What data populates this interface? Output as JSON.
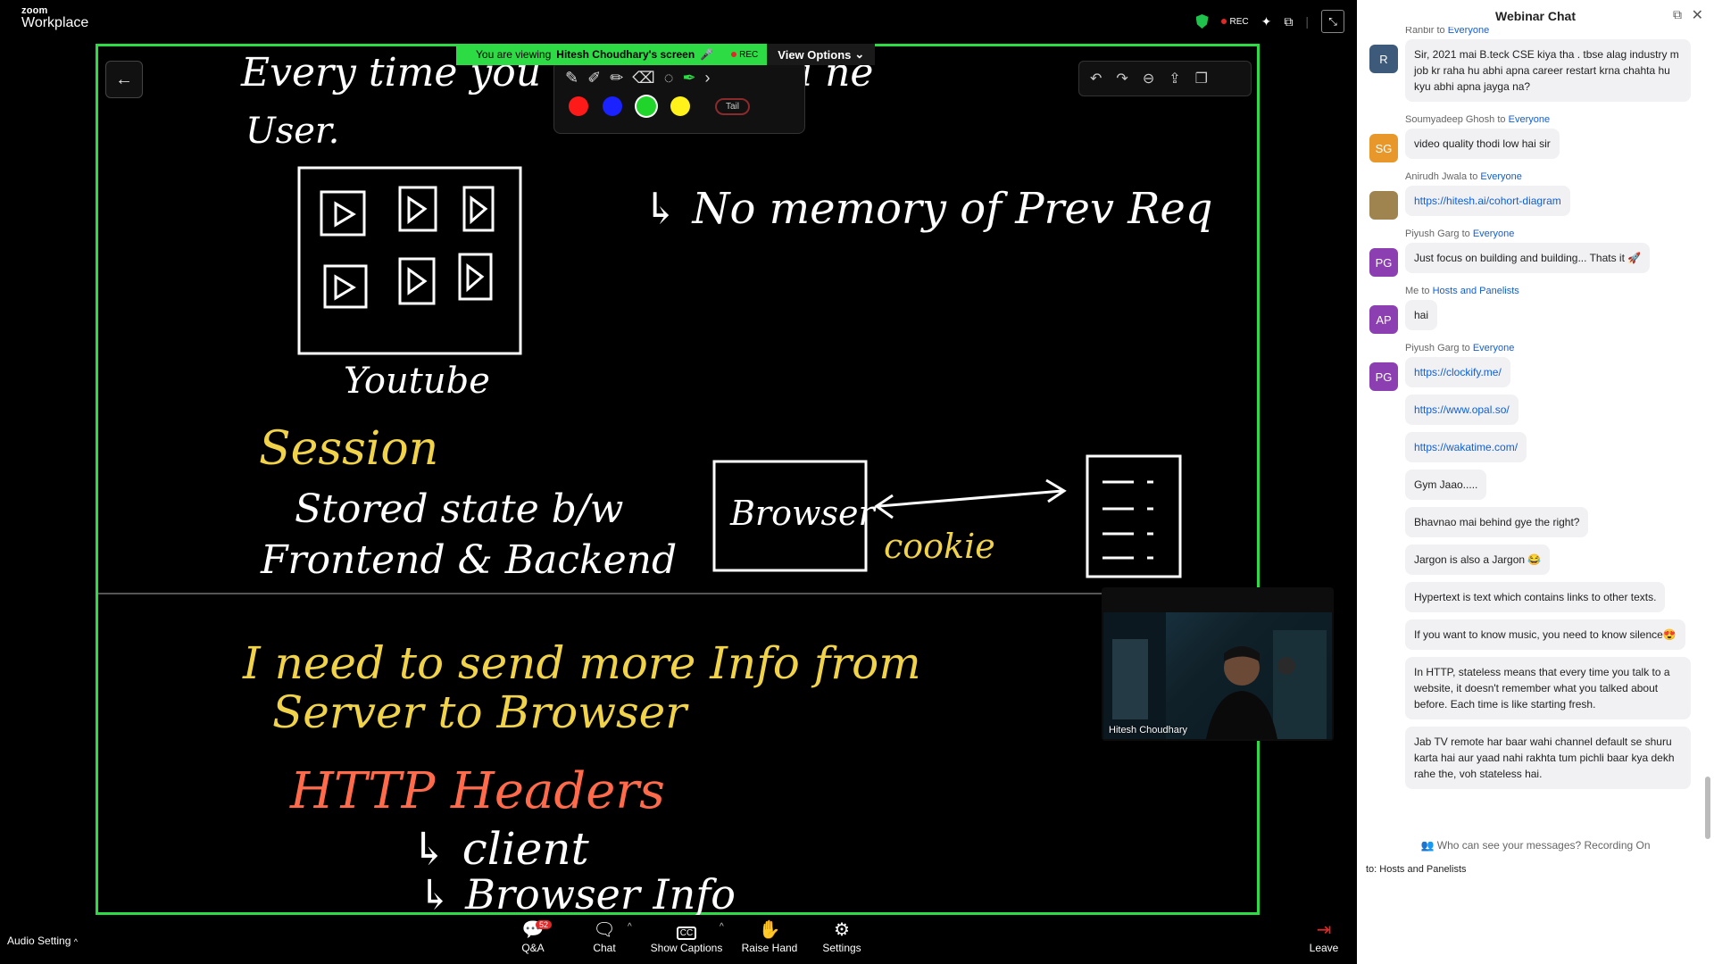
{
  "app": {
    "logo_small": "zoom",
    "logo_big": "Workplace",
    "rec_label": "REC",
    "exit_fullscreen_icon": "minimize-icon"
  },
  "share": {
    "viewing_prefix": "You are viewing",
    "viewing_name": "Hitesh Choudhary's screen",
    "rec_label": "REC",
    "view_options": "View Options",
    "tail_label": "Tail",
    "pen_colors": [
      "#ff1a1a",
      "#1a22ff",
      "#21d42b",
      "#fff21a"
    ]
  },
  "whiteboard": {
    "line1": "Every time you v… you are a ne",
    "line2": "User.",
    "youtube": "Youtube",
    "no_memory": "↳ No memory of Prev Req",
    "session": "Session",
    "stored_state": "Stored state b/w",
    "frontend_backend": "Frontend & Backend",
    "browser": "Browser",
    "cookie": "cookie",
    "need_info_1": "I need to send more Info from",
    "need_info_2": "Server to Browser",
    "http_headers": "HTTP Headers",
    "client": "↳ client",
    "browser_info": "↳ Browser Info"
  },
  "video": {
    "name": "Hitesh Choudhary"
  },
  "toolbar": {
    "audio_setting": "Audio Setting",
    "qa_label": "Q&A",
    "qa_badge": "52",
    "chat_label": "Chat",
    "captions_label": "Show Captions",
    "raise_hand_label": "Raise Hand",
    "settings_label": "Settings",
    "leave_label": "Leave"
  },
  "chat": {
    "title": "Webinar Chat",
    "partial_sender": "Ranbir",
    "partial_to": "to",
    "partial_recipient": "Everyone",
    "messages": [
      {
        "sender": "",
        "to": "",
        "recipient": "",
        "avatar": "R",
        "avatar_color": "#3d5a7a",
        "text": "Sir, 2021 mai B.teck CSE kiya tha . tbse alag industry m job kr raha hu abhi apna career restart krna chahta hu kyu abhi apna jayga na?"
      },
      {
        "sender": "Soumyadeep Ghosh",
        "to": "to",
        "recipient": "Everyone",
        "avatar": "SG",
        "avatar_color": "#e8982a",
        "text": "video quality thodi low hai sir"
      },
      {
        "sender": "Anirudh Jwala",
        "to": "to",
        "recipient": "Everyone",
        "avatar": "",
        "avatar_color": "#a0844f",
        "text": "https://hitesh.ai/cohort-diagram",
        "link": true
      },
      {
        "sender": "Piyush Garg",
        "to": "to",
        "recipient": "Everyone",
        "avatar": "PG",
        "avatar_color": "#8b3fb0",
        "text": "Just focus on building and building... Thats it 🚀"
      },
      {
        "sender": "Me",
        "to": "to",
        "recipient": "Hosts and Panelists",
        "avatar": "AP",
        "avatar_color": "#8b3fb0",
        "text": "hai"
      },
      {
        "sender": "Piyush Garg",
        "to": "to",
        "recipient": "Everyone",
        "avatar": "PG",
        "avatar_color": "#8b3fb0",
        "text": "https://clockify.me/",
        "link": true
      }
    ],
    "followups": [
      {
        "text": "https://www.opal.so/",
        "link": true
      },
      {
        "text": "https://wakatime.com/",
        "link": true
      },
      {
        "text": "Gym Jaao....."
      },
      {
        "text": "Bhavnao mai behind gye the right?"
      },
      {
        "text": "Jargon is also a Jargon 😂"
      },
      {
        "text": "Hypertext is text which contains links to other texts."
      },
      {
        "text": "If you want to know music, you need to know silence😍"
      },
      {
        "text": "In HTTP, stateless means that every time you talk to a website, it doesn't remember what you talked about before. Each time is like starting fresh."
      },
      {
        "text": "Jab TV remote har baar wahi channel default se shuru karta hai aur yaad nahi rakhta tum pichli baar kya dekh rahe the, voh stateless hai."
      }
    ],
    "footer_note": "Who can see your messages? Recording On",
    "to_line": "to: Hosts and Panelists"
  }
}
